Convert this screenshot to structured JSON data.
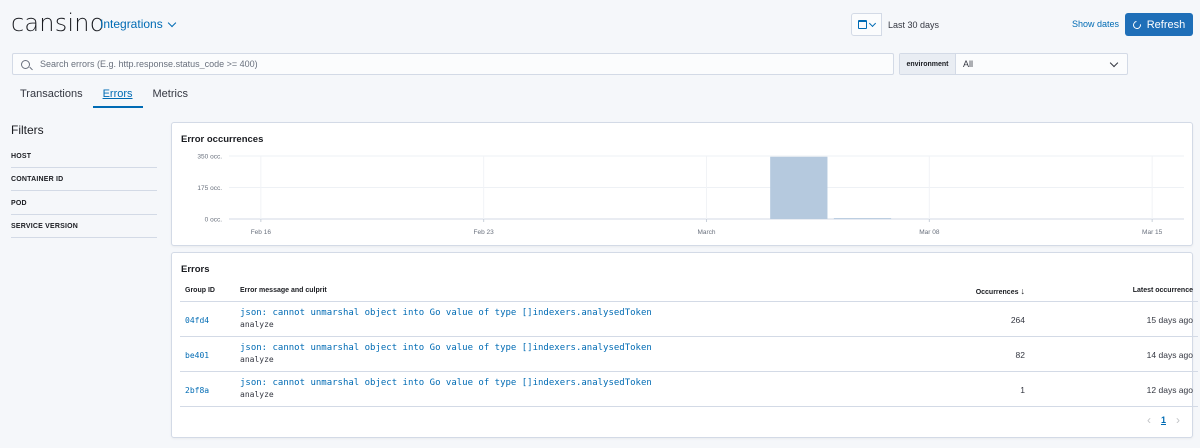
{
  "header": {
    "logo": "cansino",
    "integrations_label": "Integrations",
    "date_range": "Last 30 days",
    "show_dates": "Show dates",
    "refresh_label": "Refresh"
  },
  "search": {
    "placeholder": "Search errors (E.g. http.response.status_code >= 400)"
  },
  "environment": {
    "label": "environment",
    "value": "All"
  },
  "tabs": [
    {
      "label": "Transactions",
      "active": false
    },
    {
      "label": "Errors",
      "active": true
    },
    {
      "label": "Metrics",
      "active": false
    }
  ],
  "filters": {
    "title": "Filters",
    "items": [
      "HOST",
      "CONTAINER ID",
      "POD",
      "SERVICE VERSION"
    ]
  },
  "occurrences_panel": {
    "title": "Error occurrences"
  },
  "chart_data": {
    "type": "bar",
    "title": "Error occurrences",
    "y_ticks": [
      "350 occ.",
      "175 occ.",
      "0 occ."
    ],
    "ylim": [
      0,
      350
    ],
    "x_ticks": [
      "Feb 16",
      "Feb 23",
      "March",
      "Mar 08",
      "Mar 15"
    ],
    "x_tick_days": [
      0,
      7,
      14,
      21,
      28
    ],
    "xlim_days": [
      -1,
      29
    ],
    "bars": [
      {
        "start_day": 16,
        "end_day": 17.8,
        "value": 346
      },
      {
        "start_day": 18,
        "end_day": 19.8,
        "value": 5
      }
    ],
    "bar_color": "#b5c9de",
    "grid": true
  },
  "errors_panel": {
    "title": "Errors",
    "columns": {
      "group_id": "Group ID",
      "message": "Error message and culprit",
      "occurrences": "Occurrences",
      "latest": "Latest occurrence"
    },
    "rows": [
      {
        "group_id": "04fd4",
        "message": "json: cannot unmarshal object into Go value of type []indexers.analysedToken",
        "culprit": "analyze",
        "occurrences": "264",
        "latest": "15 days ago"
      },
      {
        "group_id": "be401",
        "message": "json: cannot unmarshal object into Go value of type []indexers.analysedToken",
        "culprit": "analyze",
        "occurrences": "82",
        "latest": "14 days ago"
      },
      {
        "group_id": "2bf8a",
        "message": "json: cannot unmarshal object into Go value of type []indexers.analysedToken",
        "culprit": "analyze",
        "occurrences": "1",
        "latest": "12 days ago"
      }
    ],
    "pagination": {
      "current": "1"
    }
  },
  "colors": {
    "accent": "#006bb4",
    "refresh_bg": "#1f6fb8",
    "page_bg": "#f5f7fa"
  }
}
